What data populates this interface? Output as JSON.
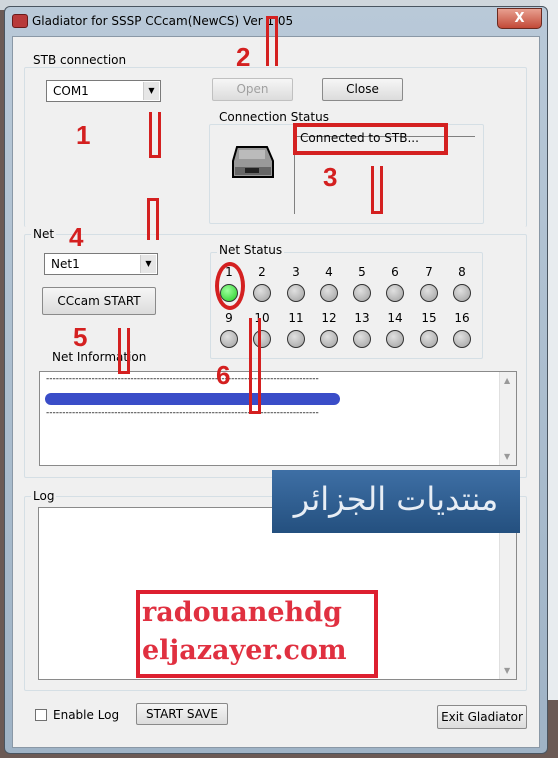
{
  "window": {
    "title": "Gladiator for SSSP CCcam(NewCS) Ver 1.05",
    "close_glyph": "X"
  },
  "stb": {
    "group_label": "STB connection",
    "port_value": "COM1",
    "open_label": "Open",
    "close_label": "Close",
    "status_group_label": "Connection Status",
    "status_text": "Connected to STB..."
  },
  "net": {
    "group_label": "Net",
    "net_value": "Net1",
    "start_label": "CCcam START",
    "info_label": "Net Information",
    "status_group_label": "Net Status",
    "leds": [
      {
        "n": "1",
        "on": true
      },
      {
        "n": "2",
        "on": false
      },
      {
        "n": "3",
        "on": false
      },
      {
        "n": "4",
        "on": false
      },
      {
        "n": "5",
        "on": false
      },
      {
        "n": "6",
        "on": false
      },
      {
        "n": "7",
        "on": false
      },
      {
        "n": "8",
        "on": false
      },
      {
        "n": "9",
        "on": false
      },
      {
        "n": "10",
        "on": false
      },
      {
        "n": "11",
        "on": false
      },
      {
        "n": "12",
        "on": false
      },
      {
        "n": "13",
        "on": false
      },
      {
        "n": "14",
        "on": false
      },
      {
        "n": "15",
        "on": false
      },
      {
        "n": "16",
        "on": false
      }
    ],
    "info_separator": "------------------------------------------------------------------------------------"
  },
  "log": {
    "group_label": "Log",
    "enable_label": "Enable Log",
    "enable_checked": false,
    "save_label": "START SAVE",
    "exit_label": "Exit Gladiator"
  },
  "annotations": {
    "steps": [
      "1",
      "2",
      "3",
      "4",
      "5",
      "6"
    ],
    "color": "#d42020"
  },
  "overlays": {
    "banner": "منتديات الجزائر",
    "stamp_line1": "radouanehdg",
    "stamp_line2": "eljazayer.com"
  }
}
